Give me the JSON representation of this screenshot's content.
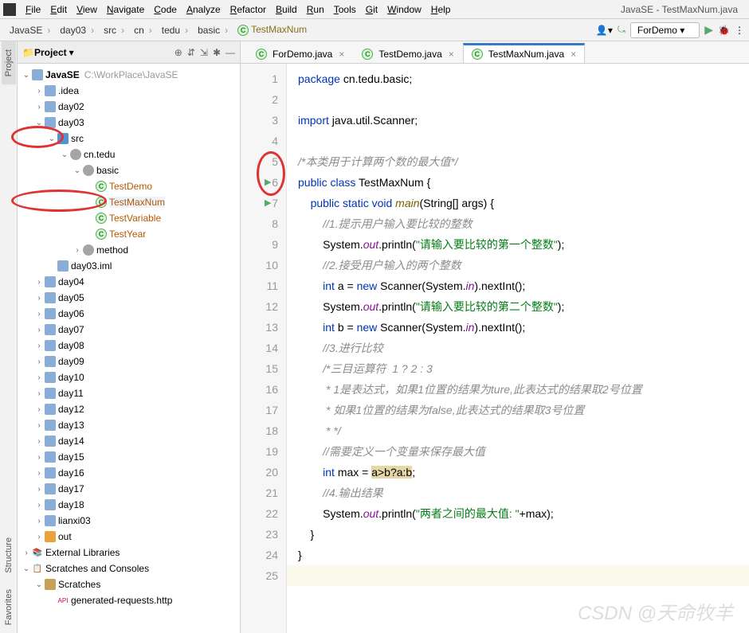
{
  "window_title": "JavaSE - TestMaxNum.java",
  "menu": [
    "File",
    "Edit",
    "View",
    "Navigate",
    "Code",
    "Analyze",
    "Refactor",
    "Build",
    "Run",
    "Tools",
    "Git",
    "Window",
    "Help"
  ],
  "breadcrumb": [
    "JavaSE",
    "day03",
    "src",
    "cn",
    "tedu",
    "basic"
  ],
  "breadcrumb_class": "TestMaxNum",
  "run_config": "ForDemo",
  "sidebar_tabs": [
    "Project",
    "Structure",
    "Favorites"
  ],
  "project_panel_title": "Project",
  "project_root": {
    "name": "JavaSE",
    "path": "C:\\WorkPlace\\JavaSE"
  },
  "tree": [
    {
      "d": 1,
      "icon": "fold",
      "lbl": ".idea",
      "chv": "›"
    },
    {
      "d": 1,
      "icon": "fold",
      "lbl": "day02",
      "chv": "›"
    },
    {
      "d": 1,
      "icon": "fold",
      "lbl": "day03",
      "chv": "⌄"
    },
    {
      "d": 2,
      "icon": "src",
      "lbl": "src",
      "chv": "⌄",
      "circ": true
    },
    {
      "d": 3,
      "icon": "pkg",
      "lbl": "cn.tedu",
      "chv": "⌄"
    },
    {
      "d": 4,
      "icon": "pkg",
      "lbl": "basic",
      "chv": "⌄"
    },
    {
      "d": 5,
      "icon": "cls",
      "lbl": "TestDemo",
      "sel": true
    },
    {
      "d": 5,
      "icon": "cls",
      "lbl": "TestMaxNum",
      "sel": true,
      "hl": true,
      "circ": true
    },
    {
      "d": 5,
      "icon": "cls",
      "lbl": "TestVariable",
      "sel": true
    },
    {
      "d": 5,
      "icon": "cls",
      "lbl": "TestYear",
      "sel": true
    },
    {
      "d": 4,
      "icon": "pkg",
      "lbl": "method",
      "chv": "›"
    },
    {
      "d": 2,
      "icon": "file",
      "lbl": "day03.iml"
    },
    {
      "d": 1,
      "icon": "fold",
      "lbl": "day04",
      "chv": "›"
    },
    {
      "d": 1,
      "icon": "fold",
      "lbl": "day05",
      "chv": "›"
    },
    {
      "d": 1,
      "icon": "fold",
      "lbl": "day06",
      "chv": "›"
    },
    {
      "d": 1,
      "icon": "fold",
      "lbl": "day07",
      "chv": "›"
    },
    {
      "d": 1,
      "icon": "fold",
      "lbl": "day08",
      "chv": "›"
    },
    {
      "d": 1,
      "icon": "fold",
      "lbl": "day09",
      "chv": "›"
    },
    {
      "d": 1,
      "icon": "fold",
      "lbl": "day10",
      "chv": "›"
    },
    {
      "d": 1,
      "icon": "fold",
      "lbl": "day11",
      "chv": "›"
    },
    {
      "d": 1,
      "icon": "fold",
      "lbl": "day12",
      "chv": "›"
    },
    {
      "d": 1,
      "icon": "fold",
      "lbl": "day13",
      "chv": "›"
    },
    {
      "d": 1,
      "icon": "fold",
      "lbl": "day14",
      "chv": "›"
    },
    {
      "d": 1,
      "icon": "fold",
      "lbl": "day15",
      "chv": "›"
    },
    {
      "d": 1,
      "icon": "fold",
      "lbl": "day16",
      "chv": "›"
    },
    {
      "d": 1,
      "icon": "fold",
      "lbl": "day17",
      "chv": "›"
    },
    {
      "d": 1,
      "icon": "fold",
      "lbl": "day18",
      "chv": "›"
    },
    {
      "d": 1,
      "icon": "fold",
      "lbl": "lianxi03",
      "chv": "›"
    },
    {
      "d": 1,
      "icon": "fold-o",
      "lbl": "out",
      "chv": "›"
    },
    {
      "d": 0,
      "icon": "lib",
      "lbl": "External Libraries",
      "chv": "›"
    },
    {
      "d": 0,
      "icon": "scr",
      "lbl": "Scratches and Consoles",
      "chv": "⌄"
    },
    {
      "d": 1,
      "icon": "fold-b",
      "lbl": "Scratches",
      "chv": "⌄"
    },
    {
      "d": 2,
      "icon": "api",
      "lbl": "generated-requests.http"
    }
  ],
  "open_tabs": [
    {
      "label": "ForDemo.java",
      "active": false
    },
    {
      "label": "TestDemo.java",
      "active": false
    },
    {
      "label": "TestMaxNum.java",
      "active": true
    }
  ],
  "code": [
    {
      "n": 1,
      "seg": [
        {
          "t": "package ",
          "c": "kw"
        },
        {
          "t": "cn.tedu.basic;"
        }
      ]
    },
    {
      "n": 2,
      "seg": []
    },
    {
      "n": 3,
      "seg": [
        {
          "t": "import ",
          "c": "kw"
        },
        {
          "t": "java.util.Scanner;"
        }
      ]
    },
    {
      "n": 4,
      "seg": []
    },
    {
      "n": 5,
      "seg": [
        {
          "t": "/*本类用于计算两个数的最大值*/",
          "c": "com"
        }
      ]
    },
    {
      "n": 6,
      "run": true,
      "seg": [
        {
          "t": "public class ",
          "c": "kw"
        },
        {
          "t": "TestMaxNum {"
        }
      ]
    },
    {
      "n": 7,
      "run": true,
      "seg": [
        {
          "t": "    "
        },
        {
          "t": "public static void ",
          "c": "kw"
        },
        {
          "t": "main",
          "c": "fn"
        },
        {
          "t": "(String[] args) {"
        }
      ]
    },
    {
      "n": 8,
      "seg": [
        {
          "t": "        "
        },
        {
          "t": "//1.提示用户输入要比较的整数",
          "c": "com"
        }
      ]
    },
    {
      "n": 9,
      "seg": [
        {
          "t": "        System."
        },
        {
          "t": "out",
          "c": "fld"
        },
        {
          "t": ".println("
        },
        {
          "t": "\"请输入要比较的第一个整数\"",
          "c": "str"
        },
        {
          "t": ");"
        }
      ]
    },
    {
      "n": 10,
      "seg": [
        {
          "t": "        "
        },
        {
          "t": "//2.接受用户输入的两个整数",
          "c": "com"
        }
      ]
    },
    {
      "n": 11,
      "seg": [
        {
          "t": "        "
        },
        {
          "t": "int ",
          "c": "kw"
        },
        {
          "t": "a = "
        },
        {
          "t": "new ",
          "c": "kw"
        },
        {
          "t": "Scanner(System."
        },
        {
          "t": "in",
          "c": "fld"
        },
        {
          "t": ").nextInt();"
        }
      ]
    },
    {
      "n": 12,
      "seg": [
        {
          "t": "        System."
        },
        {
          "t": "out",
          "c": "fld"
        },
        {
          "t": ".println("
        },
        {
          "t": "\"请输入要比较的第二个整数\"",
          "c": "str"
        },
        {
          "t": ");"
        }
      ]
    },
    {
      "n": 13,
      "seg": [
        {
          "t": "        "
        },
        {
          "t": "int ",
          "c": "kw"
        },
        {
          "t": "b = "
        },
        {
          "t": "new ",
          "c": "kw"
        },
        {
          "t": "Scanner(System."
        },
        {
          "t": "in",
          "c": "fld"
        },
        {
          "t": ").nextInt();"
        }
      ]
    },
    {
      "n": 14,
      "seg": [
        {
          "t": "        "
        },
        {
          "t": "//3.进行比较",
          "c": "com"
        }
      ]
    },
    {
      "n": 15,
      "seg": [
        {
          "t": "        "
        },
        {
          "t": "/*三目运算符  1 ? 2 : 3",
          "c": "com"
        }
      ]
    },
    {
      "n": 16,
      "seg": [
        {
          "t": "         * 1是表达式，如果1位置的结果为ture,此表达式的结果取2号位置",
          "c": "com"
        }
      ]
    },
    {
      "n": 17,
      "seg": [
        {
          "t": "         * 如果1位置的结果为false,此表达式的结果取3号位置",
          "c": "com"
        }
      ]
    },
    {
      "n": 18,
      "seg": [
        {
          "t": "         * */",
          "c": "com"
        }
      ]
    },
    {
      "n": 19,
      "seg": [
        {
          "t": "        "
        },
        {
          "t": "//需要定义一个变量来保存最大值",
          "c": "com"
        }
      ]
    },
    {
      "n": 20,
      "seg": [
        {
          "t": "        "
        },
        {
          "t": "int ",
          "c": "kw"
        },
        {
          "t": "max = "
        },
        {
          "t": "a>b?a:b",
          "c": "hlw"
        },
        {
          "t": ";"
        }
      ]
    },
    {
      "n": 21,
      "seg": [
        {
          "t": "        "
        },
        {
          "t": "//4.输出结果",
          "c": "com"
        }
      ]
    },
    {
      "n": 22,
      "seg": [
        {
          "t": "        System."
        },
        {
          "t": "out",
          "c": "fld"
        },
        {
          "t": ".println("
        },
        {
          "t": "\"两者之间的最大值: \"",
          "c": "str"
        },
        {
          "t": "+max);"
        }
      ]
    },
    {
      "n": 23,
      "seg": [
        {
          "t": "    }"
        }
      ]
    },
    {
      "n": 24,
      "seg": [
        {
          "t": "}"
        }
      ]
    },
    {
      "n": 25,
      "seg": [
        {
          "t": ""
        }
      ],
      "cur": true
    }
  ],
  "watermark": "CSDN @天命牧羊"
}
